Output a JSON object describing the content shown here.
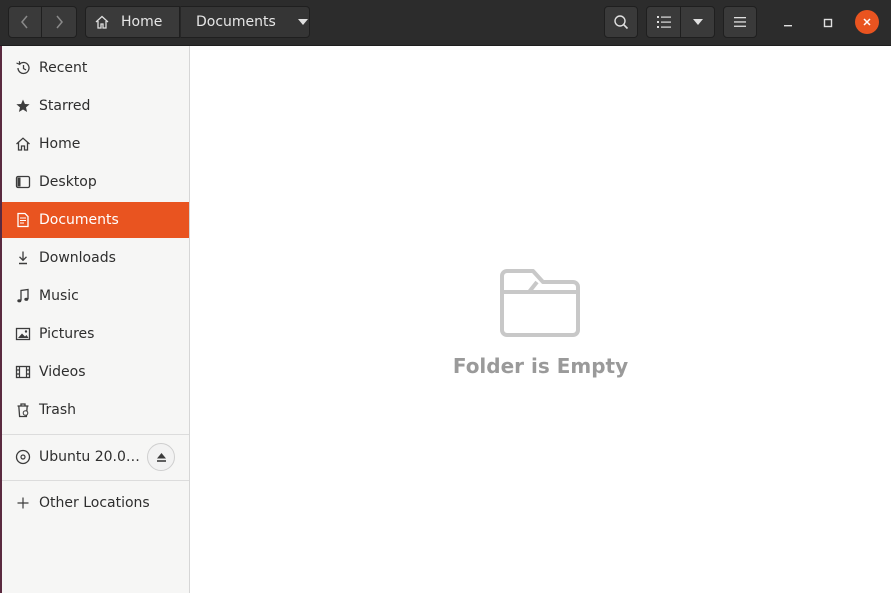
{
  "header": {
    "breadcrumb": {
      "home_label": "Home",
      "current_label": "Documents"
    }
  },
  "sidebar": {
    "items": [
      {
        "label": "Recent",
        "icon": "clock-icon"
      },
      {
        "label": "Starred",
        "icon": "star-icon"
      },
      {
        "label": "Home",
        "icon": "home-icon"
      },
      {
        "label": "Desktop",
        "icon": "desktop-icon"
      },
      {
        "label": "Documents",
        "icon": "document-icon",
        "active": true
      },
      {
        "label": "Downloads",
        "icon": "download-icon"
      },
      {
        "label": "Music",
        "icon": "music-icon"
      },
      {
        "label": "Pictures",
        "icon": "picture-icon"
      },
      {
        "label": "Videos",
        "icon": "video-icon"
      },
      {
        "label": "Trash",
        "icon": "trash-icon"
      }
    ],
    "devices": [
      {
        "label": "Ubuntu 20.0…",
        "icon": "disc-icon"
      }
    ],
    "other_locations": {
      "label": "Other Locations",
      "icon": "plus-icon"
    }
  },
  "main": {
    "empty_text": "Folder is Empty",
    "empty_icon": "folder-icon"
  },
  "colors": {
    "accent": "#e95420",
    "headerbar": "#2c2c2c",
    "sidebar_bg": "#f6f6f5",
    "empty_text": "#9a9a9a"
  }
}
